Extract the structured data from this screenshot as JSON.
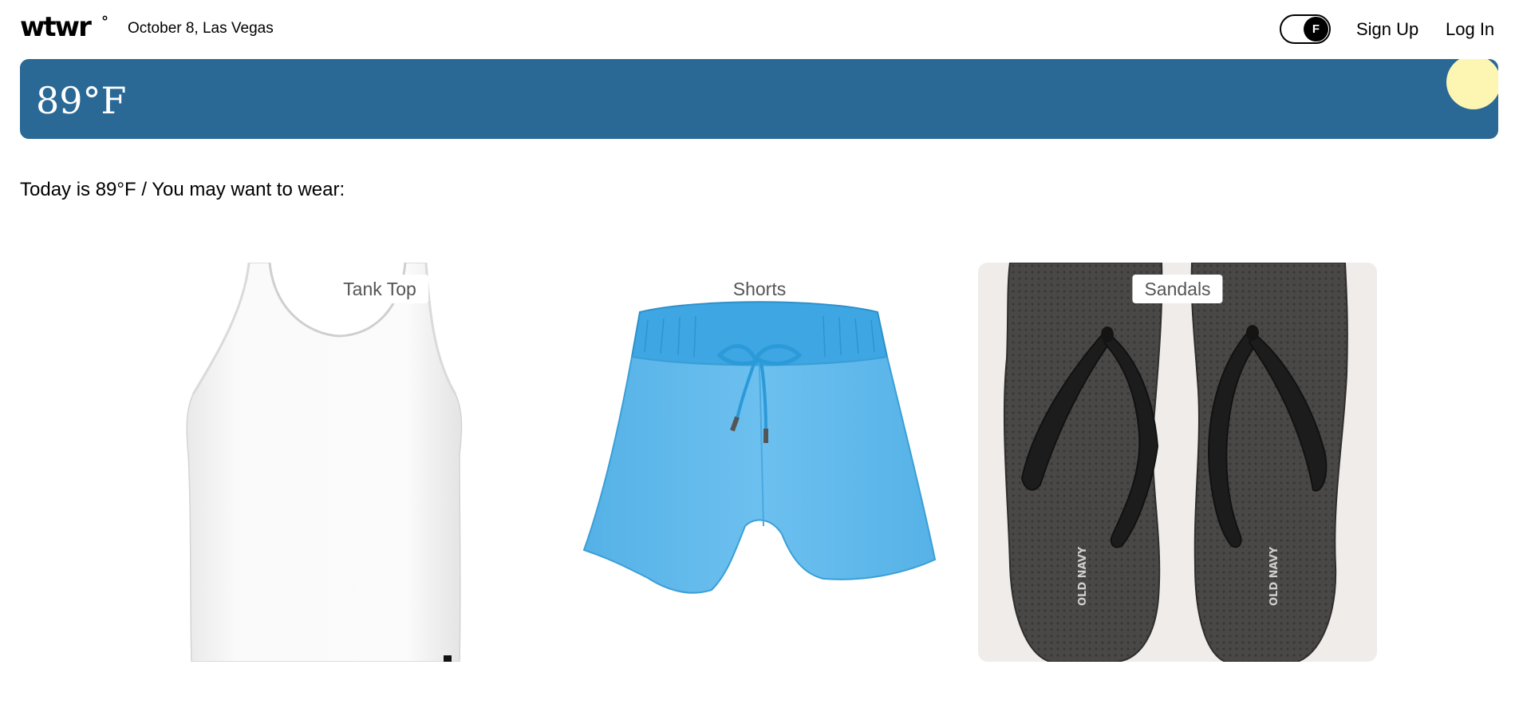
{
  "header": {
    "logo": "wtwr",
    "logo_degree": "°",
    "date_location": "October 8, Las Vegas",
    "unit_toggle": "F",
    "signup_label": "Sign Up",
    "login_label": "Log In"
  },
  "weather": {
    "temperature": "89°F",
    "condition_icon": "sun-icon",
    "card_color": "#2a6896",
    "sun_color": "#fdf6b3"
  },
  "recommendation": {
    "text": "Today is 89°F / You may want to wear:"
  },
  "items": [
    {
      "label": "Tank Top",
      "image": "white-tank-top"
    },
    {
      "label": "Shorts",
      "image": "blue-shorts"
    },
    {
      "label": "Sandals",
      "image": "black-flip-flops",
      "print_text": "OLD NAVY"
    }
  ]
}
